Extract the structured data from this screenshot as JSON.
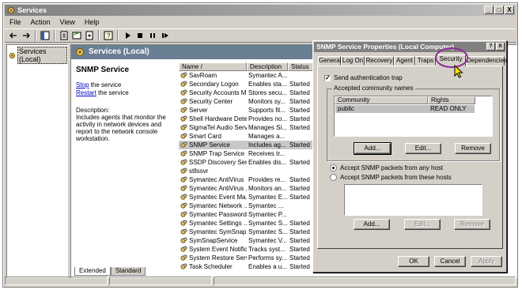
{
  "window": {
    "title": "Services",
    "controls": [
      "_",
      "□",
      "X"
    ]
  },
  "menu": [
    "File",
    "Action",
    "View",
    "Help"
  ],
  "tree": {
    "root_label": "Services (Local)"
  },
  "content_header": "Services (Local)",
  "description": {
    "service_name": "SNMP Service",
    "stop_link": "Stop",
    "stop_suffix": " the service",
    "restart_link": "Restart",
    "restart_suffix": " the service",
    "label": "Description:",
    "text": "Includes agents that monitor the activity in network devices and report to the network console workstation."
  },
  "columns": {
    "name": "Name",
    "description": "Description",
    "status": "Status"
  },
  "services": [
    {
      "name": "SavRoam",
      "description": "Symantec A...",
      "status": ""
    },
    {
      "name": "Secondary Logon",
      "description": "Enables sta...",
      "status": "Started"
    },
    {
      "name": "Security Accounts M...",
      "description": "Stores secu...",
      "status": "Started"
    },
    {
      "name": "Security Center",
      "description": "Monitors sy...",
      "status": "Started"
    },
    {
      "name": "Server",
      "description": "Supports fil...",
      "status": "Started"
    },
    {
      "name": "Shell Hardware Dete...",
      "description": "Provides no...",
      "status": "Started"
    },
    {
      "name": "SigmaTel Audio Serv...",
      "description": "Manages Si...",
      "status": "Started"
    },
    {
      "name": "Smart Card",
      "description": "Manages a...",
      "status": ""
    },
    {
      "name": "SNMP Service",
      "description": "Includes ag...",
      "status": "Started"
    },
    {
      "name": "SNMP Trap Service",
      "description": "Receives tr...",
      "status": ""
    },
    {
      "name": "SSDP Discovery Ser...",
      "description": "Enables dis...",
      "status": "Started"
    },
    {
      "name": "stllssvr",
      "description": "",
      "status": ""
    },
    {
      "name": "Symantec AntiVirus",
      "description": "Provides re...",
      "status": "Started"
    },
    {
      "name": "Symantec AntiVirus ...",
      "description": "Monitors an...",
      "status": "Started"
    },
    {
      "name": "Symantec Event Ma...",
      "description": "Symantec E...",
      "status": "Started"
    },
    {
      "name": "Symantec Network ...",
      "description": "Symantec ...",
      "status": ""
    },
    {
      "name": "Symantec Password ...",
      "description": "Symantec P...",
      "status": ""
    },
    {
      "name": "Symantec Settings ...",
      "description": "Symantec S...",
      "status": "Started"
    },
    {
      "name": "Symantec SymSnap ...",
      "description": "Symantec S...",
      "status": "Started"
    },
    {
      "name": "SymSnapService",
      "description": "Symantec V...",
      "status": "Started"
    },
    {
      "name": "System Event Notific...",
      "description": "Tracks syst...",
      "status": "Started"
    },
    {
      "name": "System Restore Serv...",
      "description": "Performs sy...",
      "status": "Started"
    },
    {
      "name": "Task Scheduler",
      "description": "Enables a u...",
      "status": "Started"
    }
  ],
  "view_tabs": [
    "Extended",
    "Standard"
  ],
  "dialog": {
    "title": "SNMP Service Properties (Local Computer)",
    "controls": [
      "?",
      "X"
    ],
    "tabs": [
      "General",
      "Log On",
      "Recovery",
      "Agent",
      "Traps",
      "Security",
      "Dependencies"
    ],
    "active_tab": "Security",
    "send_auth_trap": "Send authentication trap",
    "communities_group": "Accepted community names",
    "community_columns": [
      "Community",
      "Rights"
    ],
    "communities": [
      {
        "community": "public",
        "rights": "READ ONLY"
      }
    ],
    "buttons_top": [
      "Add...",
      "Edit...",
      "Remove"
    ],
    "radio_any": "Accept SNMP packets from any host",
    "radio_these": "Accept SNMP packets from these hosts",
    "buttons_bottom": [
      "Add...",
      "Edit...",
      "Remove"
    ],
    "ok": "OK",
    "cancel": "Cancel",
    "apply": "Apply"
  },
  "accent_colors": {
    "highlight_ring": "#8b2c9a",
    "header_band": "#6b7f93",
    "link": "#0000cc"
  }
}
